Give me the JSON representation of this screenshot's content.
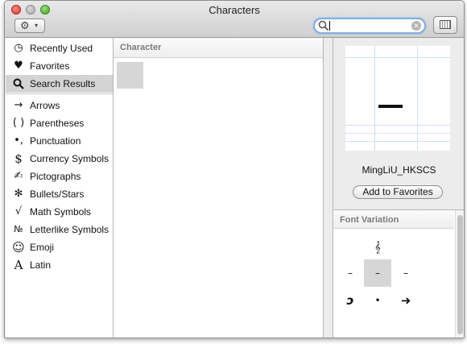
{
  "window": {
    "title": "Characters"
  },
  "toolbar": {
    "action_icon": "gear-icon",
    "action_caret": "▾",
    "search_value": "",
    "view_icon": "character-grid-icon"
  },
  "sidebar": {
    "items": [
      {
        "label": "Recently Used",
        "icon": "clock-icon",
        "glyph": "◷"
      },
      {
        "label": "Favorites",
        "icon": "heart-icon",
        "glyph": "♥"
      },
      {
        "label": "Search Results",
        "icon": "magnifier-icon",
        "glyph": "🔍",
        "selected": true
      },
      {
        "label": "Arrows",
        "icon": "arrow-icon",
        "glyph": "→"
      },
      {
        "label": "Parentheses",
        "icon": "parentheses-icon",
        "glyph": "( )"
      },
      {
        "label": "Punctuation",
        "icon": "punctuation-icon",
        "glyph": "•,"
      },
      {
        "label": "Currency Symbols",
        "icon": "dollar-icon",
        "glyph": "$"
      },
      {
        "label": "Pictographs",
        "icon": "pencil-icon",
        "glyph": "✍"
      },
      {
        "label": "Bullets/Stars",
        "icon": "asterisk-icon",
        "glyph": "✻"
      },
      {
        "label": "Math Symbols",
        "icon": "square-root-icon",
        "glyph": "√"
      },
      {
        "label": "Letterlike Symbols",
        "icon": "numero-icon",
        "glyph": "№"
      },
      {
        "label": "Emoji",
        "icon": "smiley-icon",
        "glyph": "☺"
      },
      {
        "label": "Latin",
        "icon": "latin-a-icon",
        "glyph": "A"
      }
    ]
  },
  "character_list": {
    "header": "Character"
  },
  "preview": {
    "font_name": "MingLiU_HKSCS",
    "add_favorites_label": "Add to Favorites"
  },
  "font_variation": {
    "header": "Font Variation",
    "glyphs": [
      "𝄞",
      "–",
      "–",
      "–",
      "ↄ",
      "•",
      "➜"
    ]
  }
}
